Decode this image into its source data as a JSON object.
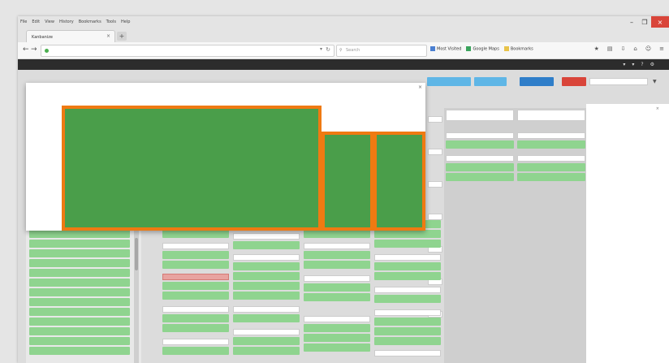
{
  "browser": {
    "menu": [
      "File",
      "Edit",
      "View",
      "History",
      "Bookmarks",
      "Tools",
      "Help"
    ],
    "tab_title": "Kanbanize",
    "tab_close": "×",
    "new_tab": "+",
    "window_controls": [
      "–",
      "❐",
      "×"
    ],
    "nav": {
      "back": "←",
      "forward": "→",
      "home": "⌂"
    },
    "url_dropdown": "▾",
    "url_reload": "↻",
    "search_placeholder": "Search",
    "bookmarks": [
      "Most Visited",
      "Google Maps",
      "Bookmarks"
    ],
    "tool_icons": [
      "★",
      "▤",
      "⇩",
      "⌂",
      "☺",
      "≡"
    ]
  },
  "app": {
    "header_items": [
      "",
      "",
      ""
    ],
    "header_right": [
      "▾",
      "▾",
      "?",
      "⚙"
    ],
    "toolbar": {
      "btn1": "",
      "btn2": "",
      "btn3": "",
      "btn4": "",
      "search_placeholder": "",
      "filter_icon": "▼"
    },
    "columns": {
      "h1": "",
      "h2": "",
      "h3": "",
      "h4": ""
    },
    "sidebar": {
      "header": "",
      "item": "",
      "close": "×"
    }
  },
  "modal": {
    "title": "",
    "close": "×",
    "tiles": [
      {
        "label": ""
      },
      {
        "label": ""
      },
      {
        "label": ""
      }
    ]
  },
  "colors": {
    "treemap_green": "#4a9e4a",
    "treemap_border": "#ef7a12",
    "card_green": "#8fd48f",
    "card_red": "#e8a3a0",
    "button_blue": "#2f7ec9",
    "button_light_blue": "#5fb6e6",
    "button_red": "#d9453a"
  }
}
